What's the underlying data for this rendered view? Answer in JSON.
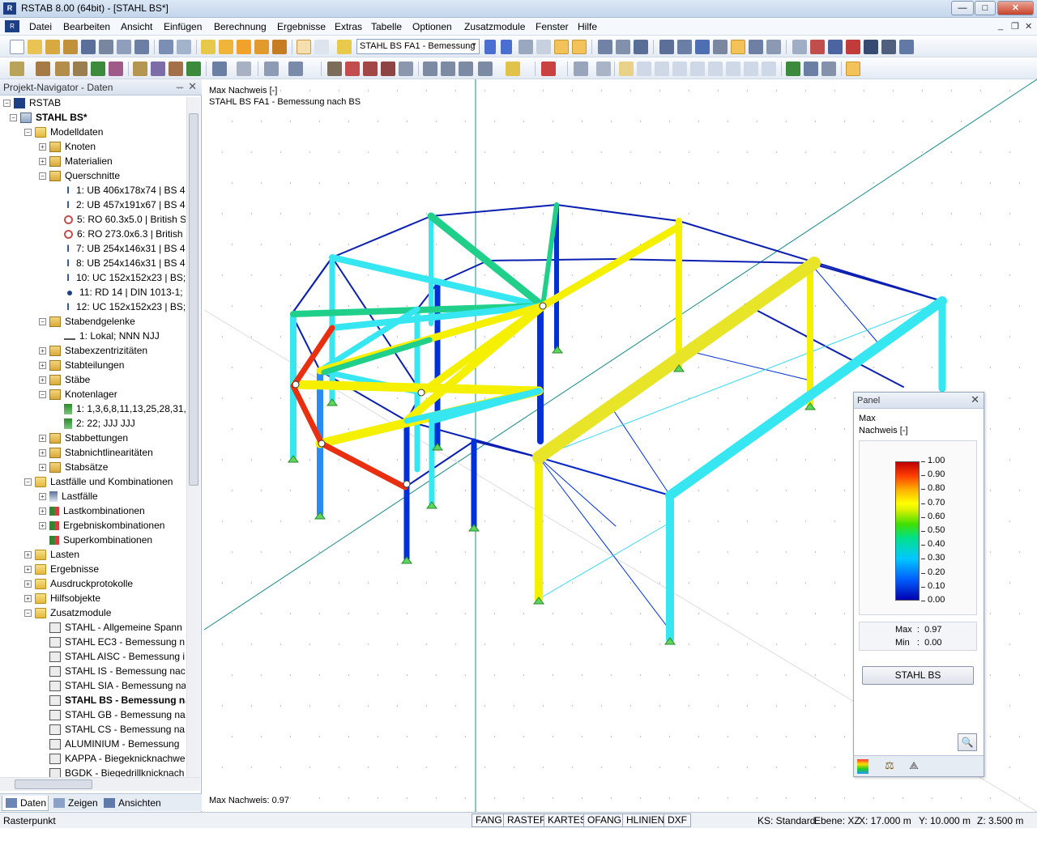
{
  "window": {
    "title": "RSTAB 8.00 (64bit) - [STAHL BS*]",
    "minimize": "—",
    "maximize": "□",
    "close": "✕",
    "mdi_minimize": "_",
    "mdi_restore": "❐",
    "mdi_close": "✕"
  },
  "menu": [
    "Datei",
    "Bearbeiten",
    "Ansicht",
    "Einfügen",
    "Berechnung",
    "Ergebnisse",
    "Extras",
    "Tabelle",
    "Optionen",
    "Zusatzmodule",
    "Fenster",
    "Hilfe"
  ],
  "toolbar": {
    "loadcase_combo": "STAHL BS FA1 - Bemessung"
  },
  "navigator": {
    "title": "Projekt-Navigator - Daten",
    "pin": "ᅲ",
    "close": "✕",
    "tree": [
      {
        "label": "RSTAB",
        "icon": "rstab-icon"
      },
      {
        "label": "STAHL BS*",
        "icon": "project-icon",
        "bold": true
      },
      {
        "label": "Modelldaten",
        "icon": "folder-icon"
      },
      {
        "label": "Knoten",
        "icon": "folder-item-icon"
      },
      {
        "label": "Materialien",
        "icon": "folder-item-icon"
      },
      {
        "label": "Querschnitte",
        "icon": "folder-item-icon"
      },
      {
        "label": "1: UB 406x178x74 | BS 4-",
        "icon": "ibeam-icon"
      },
      {
        "label": "2: UB 457x191x67 | BS 4-",
        "icon": "ibeam-icon"
      },
      {
        "label": "5: RO 60.3x5.0 | British S",
        "icon": "pipe-icon"
      },
      {
        "label": "6: RO 273.0x6.3 | British",
        "icon": "pipe-icon"
      },
      {
        "label": "7: UB 254x146x31 | BS 4-",
        "icon": "ibeam-icon"
      },
      {
        "label": "8: UB 254x146x31 | BS 4-",
        "icon": "ibeam-icon"
      },
      {
        "label": "10: UC 152x152x23 | BS;",
        "icon": "ibeam-icon"
      },
      {
        "label": "11: RD 14 | DIN 1013-1; (",
        "icon": "round-bar-icon"
      },
      {
        "label": "12: UC 152x152x23 | BS;",
        "icon": "ibeam-icon"
      },
      {
        "label": "Stabendgelenke",
        "icon": "folder-item-icon"
      },
      {
        "label": "1: Lokal; NNN NJJ",
        "icon": "hinge-icon"
      },
      {
        "label": "Stabexzentrizitäten",
        "icon": "folder-item-icon"
      },
      {
        "label": "Stabteilungen",
        "icon": "folder-item-icon"
      },
      {
        "label": "Stäbe",
        "icon": "folder-item-icon"
      },
      {
        "label": "Knotenlager",
        "icon": "folder-item-icon"
      },
      {
        "label": "1: 1,3,6,8,11,13,25,28,31,",
        "icon": "support-icon"
      },
      {
        "label": "2: 22; JJJ JJJ",
        "icon": "support-icon"
      },
      {
        "label": "Stabbettungen",
        "icon": "folder-item-icon"
      },
      {
        "label": "Stabnichtlinearitäten",
        "icon": "folder-item-icon"
      },
      {
        "label": "Stabsätze",
        "icon": "folder-item-icon"
      },
      {
        "label": "Lastfälle und Kombinationen",
        "icon": "folder-icon"
      },
      {
        "label": "Lastfälle",
        "icon": "loadcase-icon"
      },
      {
        "label": "Lastkombinationen",
        "icon": "combination-icon"
      },
      {
        "label": "Ergebniskombinationen",
        "icon": "combination-icon"
      },
      {
        "label": "Superkombinationen",
        "icon": "combination-icon"
      },
      {
        "label": "Lasten",
        "icon": "folder-icon"
      },
      {
        "label": "Ergebnisse",
        "icon": "folder-icon"
      },
      {
        "label": "Ausdruckprotokolle",
        "icon": "folder-icon"
      },
      {
        "label": "Hilfsobjekte",
        "icon": "folder-icon"
      },
      {
        "label": "Zusatzmodule",
        "icon": "folder-icon"
      },
      {
        "label": "STAHL - Allgemeine Spann",
        "icon": "module-icon"
      },
      {
        "label": "STAHL EC3 - Bemessung n",
        "icon": "module-icon"
      },
      {
        "label": "STAHL AISC - Bemessung i",
        "icon": "module-icon"
      },
      {
        "label": "STAHL IS - Bemessung nac",
        "icon": "module-icon"
      },
      {
        "label": "STAHL SIA - Bemessung na",
        "icon": "module-icon"
      },
      {
        "label": "STAHL BS - Bemessung na",
        "icon": "module-icon",
        "bold": true
      },
      {
        "label": "STAHL GB - Bemessung na",
        "icon": "module-icon"
      },
      {
        "label": "STAHL CS - Bemessung na",
        "icon": "module-icon"
      },
      {
        "label": "ALUMINIUM - Bemessung",
        "icon": "module-icon"
      },
      {
        "label": "KAPPA - Biegeknicknachwe",
        "icon": "module-icon"
      },
      {
        "label": "BGDK - Biegedrillknicknach",
        "icon": "module-icon"
      }
    ],
    "tabs": [
      "Daten",
      "Zeigen",
      "Ansichten"
    ]
  },
  "viewport": {
    "header_line1": "Max Nachweis [-]",
    "header_line2": "STAHL BS FA1 - Bemessung nach BS",
    "footer": "Max Nachweis: 0.97"
  },
  "panel": {
    "title": "Panel",
    "close": "✕",
    "label1": "Max",
    "label2": "Nachweis [-]",
    "scale": [
      "1.00",
      "0.90",
      "0.80",
      "0.70",
      "0.60",
      "0.50",
      "0.40",
      "0.30",
      "0.20",
      "0.10",
      "0.00"
    ],
    "max_label": "Max",
    "max_value": "0.97",
    "min_label": "Min",
    "min_value": "0.00",
    "sep": ":",
    "module_button": "STAHL BS",
    "zoom": "🔍"
  },
  "status": {
    "left": "Rasterpunkt",
    "buttons": [
      "FANG",
      "RASTER",
      "KARTES",
      "OFANG",
      "HLINIEN",
      "DXF"
    ],
    "ks": "KS: Standard",
    "ebene": "Ebene: XZ",
    "x": "X:  17.000 m",
    "y": "Y:  10.000 m",
    "z": "Z:  3.500 m"
  },
  "colors": {
    "accent": "#1d3f86",
    "utilization_low": "#0000b0",
    "utilization_mid": "#00e0ff",
    "utilization_high": "#ffff00",
    "utilization_max": "#e02000"
  }
}
